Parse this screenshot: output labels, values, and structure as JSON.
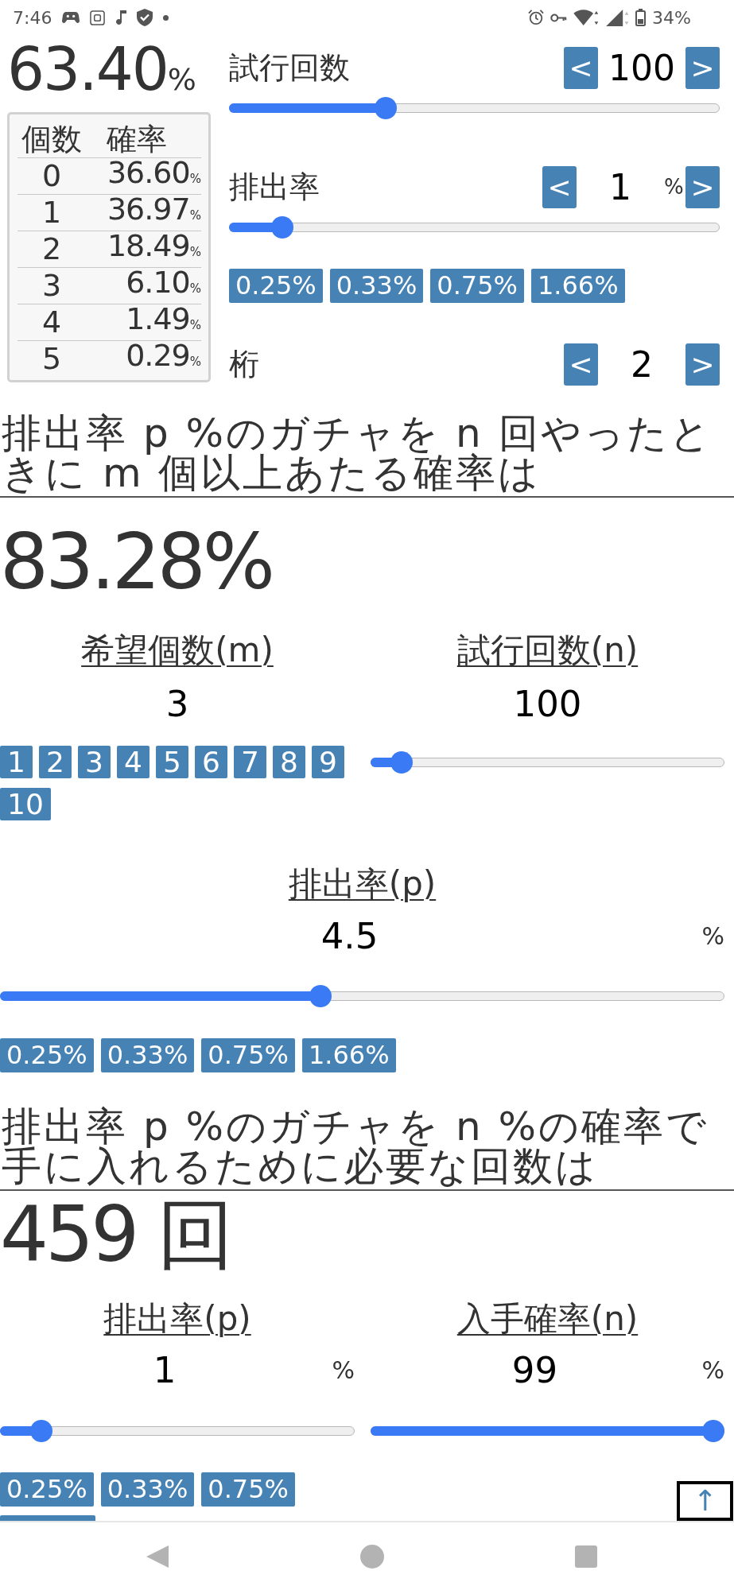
{
  "status_bar": {
    "time": "7:46",
    "battery": "34%"
  },
  "summary": {
    "value": "63.40",
    "unit": "%",
    "table": {
      "columns": [
        "個数",
        "確率"
      ],
      "rows": [
        {
          "count": "0",
          "probability": "36.60",
          "unit": "%"
        },
        {
          "count": "1",
          "probability": "36.97",
          "unit": "%"
        },
        {
          "count": "2",
          "probability": "18.49",
          "unit": "%"
        },
        {
          "count": "3",
          "probability": "6.10",
          "unit": "%"
        },
        {
          "count": "4",
          "probability": "1.49",
          "unit": "%"
        },
        {
          "count": "5",
          "probability": "0.29",
          "unit": "%"
        }
      ]
    }
  },
  "controls": [
    {
      "kind": "stepper_slider",
      "label": "試行回数",
      "decrement": "<",
      "value": "100",
      "increment": ">",
      "level": 0.31
    },
    {
      "kind": "stepper_slider",
      "label": "排出率",
      "decrement": "<",
      "value": "1",
      "unit": "%",
      "increment": ">",
      "level": 0.09,
      "presets": [
        "0.25%",
        "0.33%",
        "0.75%",
        "1.66%"
      ]
    },
    {
      "kind": "stepper",
      "label": "桁",
      "decrement": "<",
      "value": "2",
      "increment": ">"
    }
  ],
  "at_least": {
    "heading": "排出率 p %のガチャを n 回やったときに m 個以上あたる確率は",
    "result": "83.28%",
    "fields": [
      {
        "kind": "number_buttons",
        "label": "希望個数(m)",
        "value": "3",
        "buttons": [
          "1",
          "2",
          "3",
          "4",
          "5",
          "6",
          "7",
          "8",
          "9",
          "10"
        ]
      },
      {
        "kind": "slider",
        "label": "試行回数(n)",
        "value": "100",
        "level": 0.06
      }
    ],
    "rate": {
      "kind": "slider",
      "label": "排出率(p)",
      "value": "4.5",
      "unit": "%",
      "level": 0.44,
      "presets": [
        "0.25%",
        "0.33%",
        "0.75%",
        "1.66%"
      ]
    }
  },
  "required_trials": {
    "heading": "排出率 p %のガチャを n %の確率で手に入れるために必要な回数は",
    "result": "459 回",
    "fields": [
      {
        "kind": "slider",
        "label": "排出率(p)",
        "value": "1",
        "unit": "%",
        "level": 0.09,
        "presets": [
          "0.25%",
          "0.33%",
          "0.75%"
        ],
        "partly_hidden_button": true
      },
      {
        "kind": "slider",
        "label": "入手確率(n)",
        "value": "99",
        "unit": "%",
        "level": 1.0
      }
    ]
  },
  "scroll_top_button": "↑"
}
